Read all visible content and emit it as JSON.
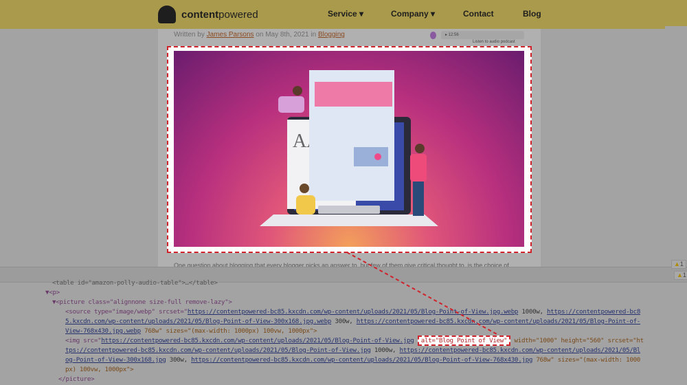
{
  "header": {
    "brand_bold": "content",
    "brand_rest": "powered",
    "nav": [
      "Service ▾",
      "Company ▾",
      "Contact",
      "Blog"
    ]
  },
  "byline": {
    "prefix": "Written by ",
    "author": "James Parsons",
    "middle": " on May 8th, 2021 in ",
    "category": "Blogging"
  },
  "podcast": {
    "time": "▸  12:56",
    "label": "Listen to audio podcast"
  },
  "article": {
    "first_line": "One question about blogging that every blogger picks an answer to, but few of them give critical thought to, is the choice of"
  },
  "devtools": {
    "warnings": [
      "1",
      "1"
    ],
    "lines": {
      "l0": "<table id=\"amazon-polly-audio-table\">…</table>",
      "l1": "▼<p>",
      "l2": "▼<picture class=\"alignnone size-full remove-lazy\">",
      "source_open": "<source type=\"image/webp\" srcset=\"",
      "src1": "https://contentpowered-bc85.kxcdn.com/wp-content/uploads/2021/05/Blog-Point-of-View.jpg.webp",
      "w1000": " 1000w, ",
      "src2a": "https://contentpowered-bc8",
      "src2b": "5.kxcdn.com/wp-content/uploads/2021/05/Blog-Point-of-View-300x168.jpg.webp",
      "w300": " 300w, ",
      "src3a": "https://contentpowered-bc85.kxcdn.com/wp-content/uploads/2021/05/Blog-Point-of-",
      "src3b": "View-768x430.jpg.webp",
      "w768_sizes": " 768w\" sizes=\"(max-width: 1000px) 100vw, 1000px\">",
      "img_open": "<img src=\"",
      "img_src": "https://contentpowered-bc85.kxcdn.com/wp-content/uploads/2021/05/Blog-Point-of-View.jpg",
      "alt": "alt=\"Blog Point of View\"",
      "img_rest": " width=\"1000\" height=\"560\" srcset=\"ht",
      "isrc1": "tps://contentpowered-bc85.kxcdn.com/wp-content/uploads/2021/05/Blog-Point-of-View.jpg",
      "isrc2a": "https://contentpowered-bc85.kxcdn.com/wp-content/uploads/2021/05/Bl",
      "isrc2b": "og-Point-of-View-300x168.jpg",
      "isrc3": "https://contentpowered-bc85.kxcdn.com/wp-content/uploads/2021/05/Blog-Point-of-View-768x430.jpg",
      "isizes": " 768w\" sizes=\"(max-width: 1000",
      "isizes2": "px) 100vw, 1000px\">",
      "close_picture": "</picture>"
    }
  },
  "colors": {
    "highlight": "#d0222a",
    "header": "#aa9a4b"
  }
}
